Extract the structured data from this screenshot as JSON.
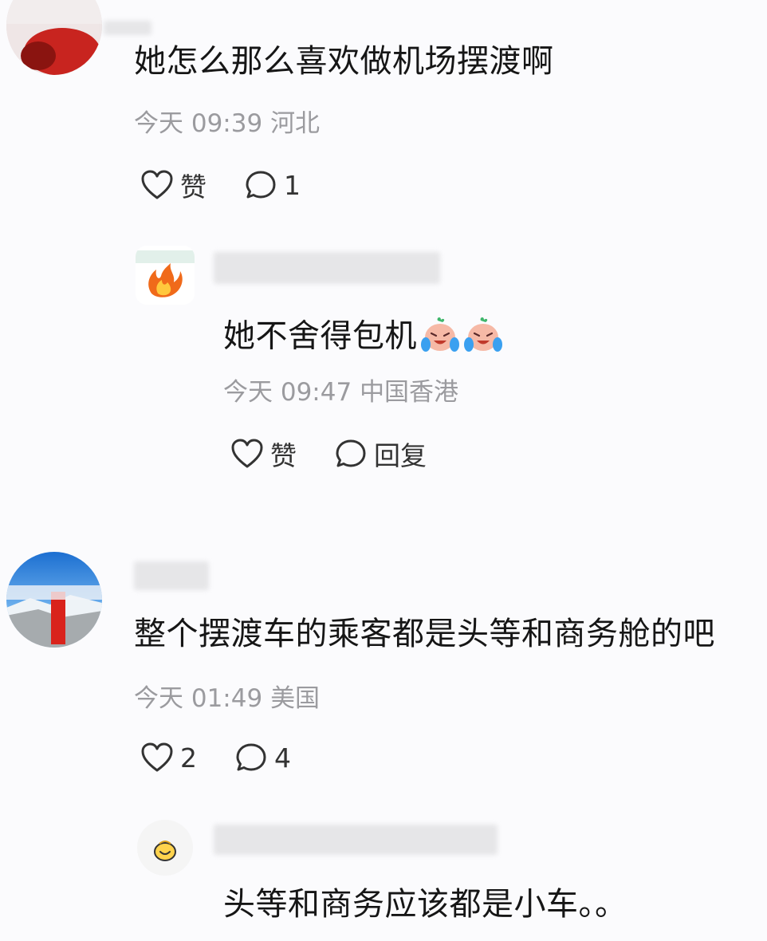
{
  "comments": [
    {
      "text": "她怎么那么喜欢做机场摆渡啊",
      "time": "今天 09:39",
      "location": "河北",
      "like_label": "赞",
      "reply_count": "1",
      "avatar_icon": "photo-avatar-icon",
      "replies": [
        {
          "text": "她不舍得包机",
          "emoji": [
            "crying-laughing-face-icon",
            "crying-laughing-face-icon"
          ],
          "time": "今天 09:47",
          "location": "中国香港",
          "like_label": "赞",
          "reply_label": "回复",
          "avatar_icon": "flame-avatar-icon"
        }
      ]
    },
    {
      "text": "整个摆渡车的乘客都是头等和商务舱的吧",
      "time": "今天 01:49",
      "location": "美国",
      "like_count": "2",
      "reply_count": "4",
      "avatar_icon": "sky-photo-avatar-icon",
      "replies": [
        {
          "text": "头等和商务应该都是小车。。",
          "avatar_icon": "sticker-avatar-icon"
        }
      ]
    }
  ],
  "colors": {
    "background": "#fbfbfd",
    "text_primary": "#161616",
    "text_meta": "#9b9b9f",
    "icon_stroke": "#333333"
  }
}
